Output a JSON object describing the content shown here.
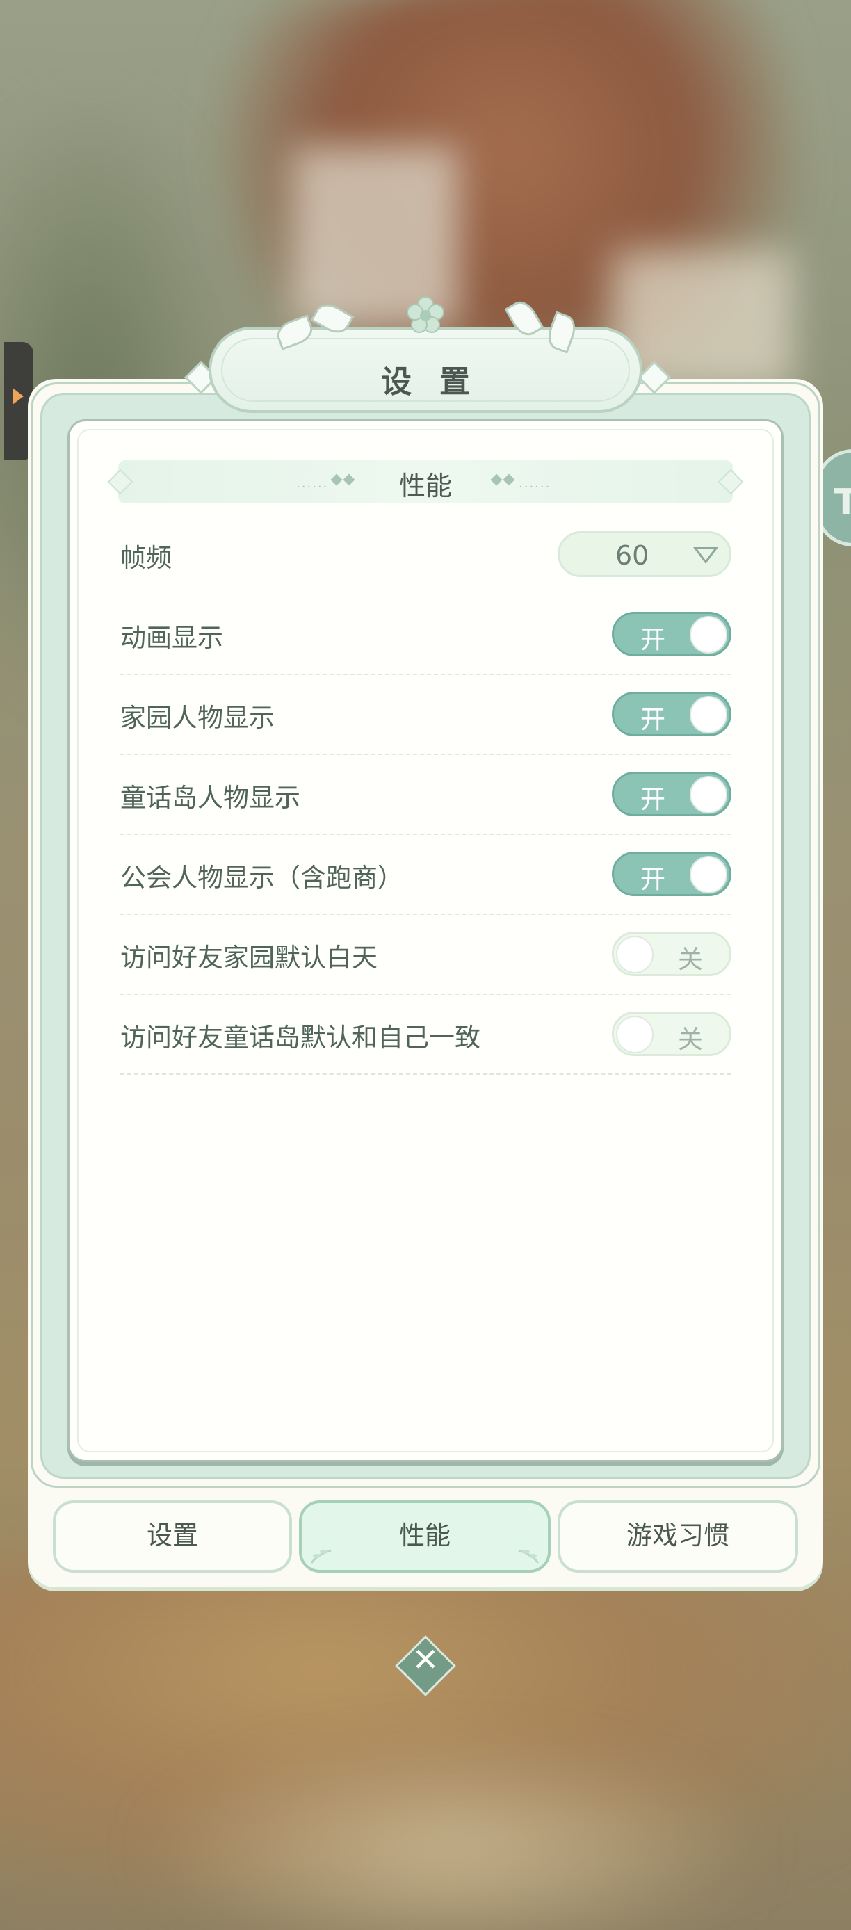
{
  "dialog": {
    "title": "设置",
    "section_title": "性能"
  },
  "frame_rate": {
    "label": "帧频",
    "value": "60"
  },
  "settings": [
    {
      "label": "动画显示",
      "state": "开",
      "on": true
    },
    {
      "label": "家园人物显示",
      "state": "开",
      "on": true
    },
    {
      "label": "童话岛人物显示",
      "state": "开",
      "on": true
    },
    {
      "label": "公会人物显示（含跑商）",
      "state": "开",
      "on": true
    },
    {
      "label": "访问好友家园默认白天",
      "state": "关",
      "on": false
    },
    {
      "label": "访问好友童话岛默认和自己一致",
      "state": "关",
      "on": false
    }
  ],
  "tabs": [
    {
      "label": "设置",
      "active": false
    },
    {
      "label": "性能",
      "active": true
    },
    {
      "label": "游戏习惯",
      "active": false
    }
  ],
  "side_circle_text": "To",
  "colors": {
    "toggle_on": "#8bc3b5",
    "toggle_off": "#eef8ec",
    "panel_green": "#d6eadf",
    "text": "#51645c"
  },
  "icons": [
    "chevron-right-icon",
    "dropdown-triangle-icon",
    "close-icon",
    "flower-ornament-icon"
  ]
}
